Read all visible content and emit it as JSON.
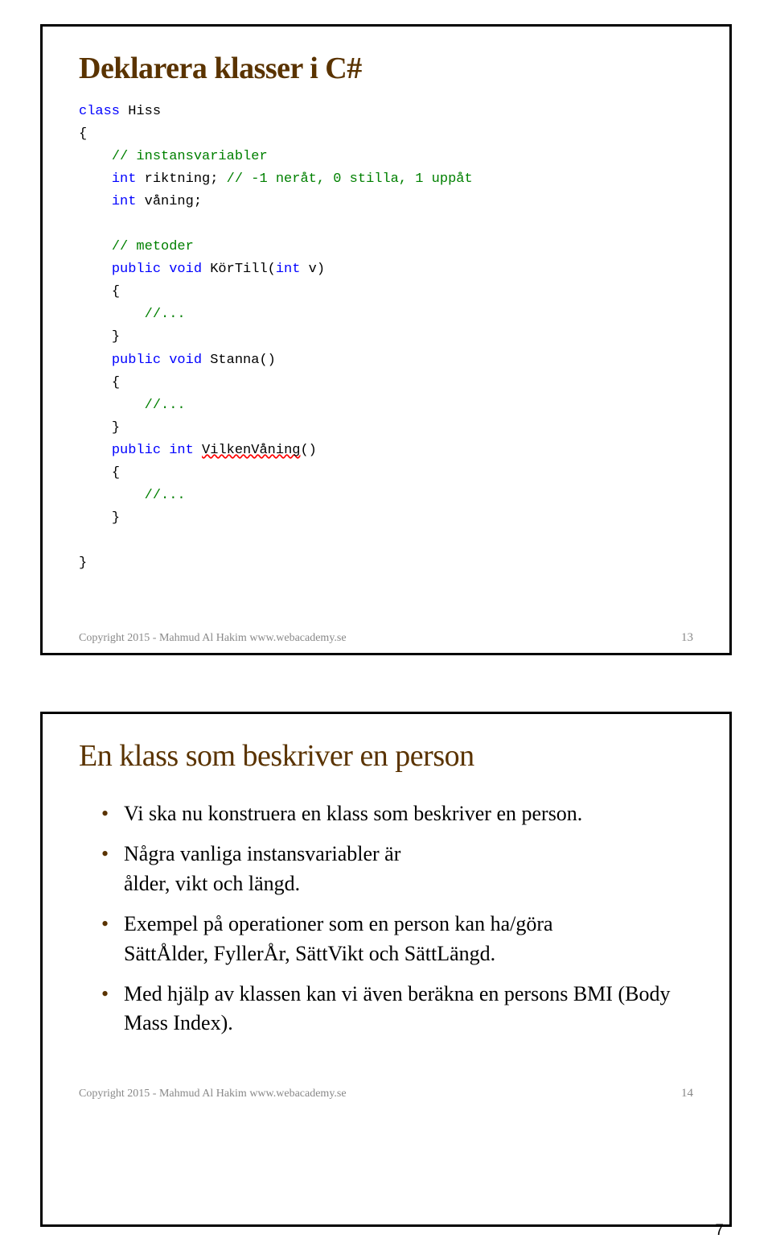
{
  "slide1": {
    "title": "Deklarera klasser i C#",
    "code": {
      "l1": {
        "kw": "class",
        "id": " Hiss"
      },
      "l2": "{",
      "l3": {
        "pad": "    ",
        "cm": "// instansvariabler"
      },
      "l4": {
        "pad": "    ",
        "kw": "int",
        "id": " riktning; ",
        "cm": "// -1 neråt, 0 stilla, 1 uppåt"
      },
      "l5": {
        "pad": "    ",
        "kw": "int",
        "id": " våning;"
      },
      "l6": "",
      "l7": {
        "pad": "    ",
        "cm": "// metoder"
      },
      "l8": {
        "pad": "    ",
        "kw": "public void",
        "id": " KörTill(",
        "kw2": "int",
        "id2": " v)"
      },
      "l9": {
        "pad": "    ",
        "t": "{"
      },
      "l10": {
        "pad": "        ",
        "cm": "//..."
      },
      "l11": {
        "pad": "    ",
        "t": "}"
      },
      "l12": {
        "pad": "    ",
        "kw": "public void",
        "id": " Stanna()"
      },
      "l13": {
        "pad": "    ",
        "t": "{"
      },
      "l14": {
        "pad": "        ",
        "cm": "//..."
      },
      "l15": {
        "pad": "    ",
        "t": "}"
      },
      "l16": {
        "pad": "    ",
        "kw": "public int",
        "id": " ",
        "sq": "VilkenVåning",
        "id2": "()"
      },
      "l17": {
        "pad": "    ",
        "t": "{"
      },
      "l18": {
        "pad": "        ",
        "cm": "//..."
      },
      "l19": {
        "pad": "    ",
        "t": "}"
      },
      "l20": "",
      "l21": "}"
    },
    "copyright": "Copyright 2015 - Mahmud Al Hakim www.webacademy.se",
    "pagenum": "13"
  },
  "slide2": {
    "title": "En klass som beskriver en person",
    "bullets": [
      "Vi ska nu konstruera en klass som beskriver en person.",
      "Några vanliga instansvariabler är\nålder, vikt och längd.",
      "Exempel på operationer som en person kan ha/göra\nSättÅlder, FyllerÅr, SättVikt och SättLängd.",
      "Med hjälp av klassen kan vi även beräkna en persons BMI (Body Mass Index)."
    ],
    "copyright": "Copyright 2015 - Mahmud Al Hakim www.webacademy.se",
    "pagenum": "14"
  },
  "outer_page": "7"
}
